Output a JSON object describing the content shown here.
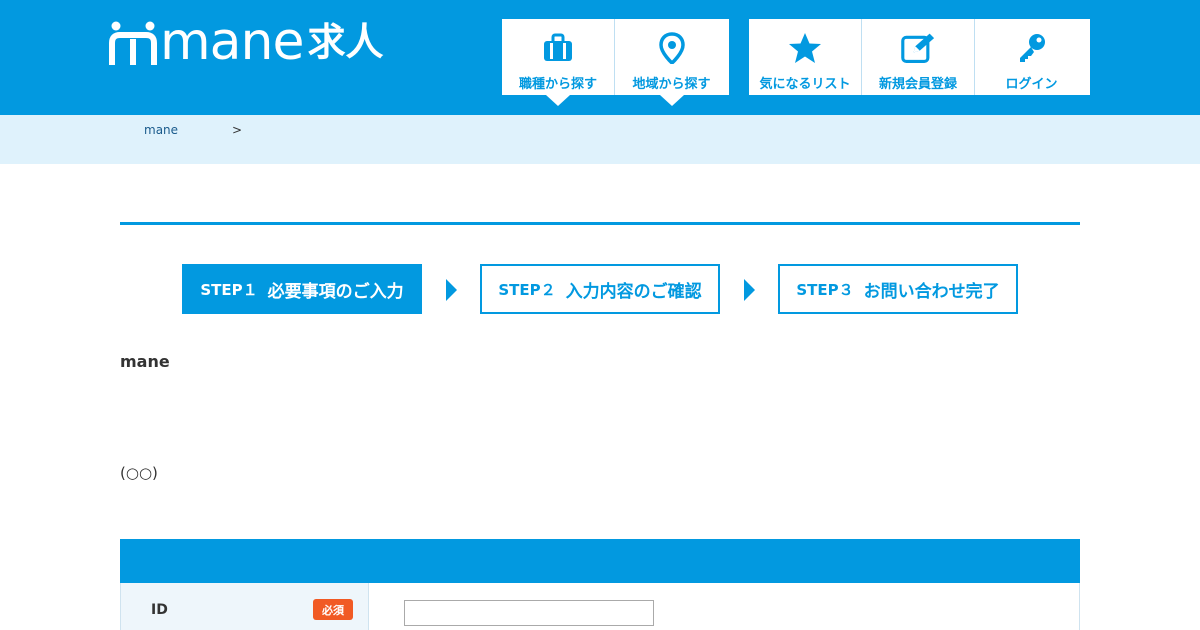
{
  "header": {
    "logo_text": "mane",
    "logo_kanji": "求人",
    "colors": {
      "primary": "#0299e0",
      "nav_bg": "#ffffff",
      "accent_required": "#f15a24"
    },
    "nav": [
      {
        "label": "職種から探す",
        "icon": "briefcase-icon"
      },
      {
        "label": "地域から探す",
        "icon": "map-pin-icon"
      },
      {
        "label": "気になるリスト",
        "icon": "star-icon"
      },
      {
        "label": "新規会員登録",
        "icon": "edit-icon"
      },
      {
        "label": "ログイン",
        "icon": "key-icon"
      }
    ]
  },
  "breadcrumb": {
    "home": "mane",
    "separator": ">"
  },
  "steps": [
    {
      "num": "STEP１",
      "text": "必要事項のご入力",
      "active": true
    },
    {
      "num": "STEP２",
      "text": "入力内容のご確認",
      "active": false
    },
    {
      "num": "STEP３",
      "text": "お問い合わせ完了",
      "active": false
    }
  ],
  "content": {
    "lead": "mane",
    "note": "(○○)"
  },
  "form": {
    "rows": [
      {
        "label": "ID",
        "required_badge": "必須",
        "value": ""
      }
    ]
  }
}
